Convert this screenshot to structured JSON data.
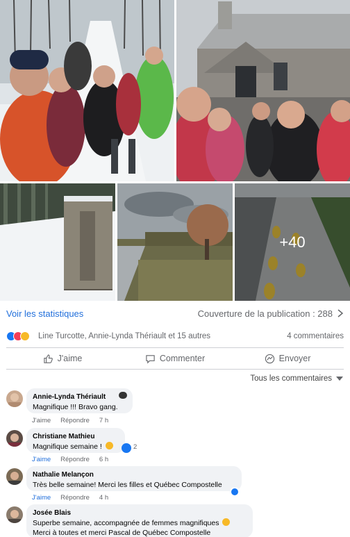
{
  "photos": {
    "more_count": "+40"
  },
  "stats": {
    "view_stats_label": "Voir les statistiques",
    "reach_label": "Couverture de la publication : 288"
  },
  "reactions": {
    "names": "Line Turcotte, Annie-Lynda Thériault et 15 autres",
    "comment_count": "4 commentaires"
  },
  "actions": {
    "like": "J'aime",
    "comment": "Commenter",
    "send": "Envoyer"
  },
  "filter": {
    "label": "Tous les commentaires"
  },
  "comments": [
    {
      "author": "Annie-Lynda Thériault",
      "text": "Magnifique !!! Bravo gang.",
      "like": "J'aime",
      "reply": "Répondre",
      "time": "7 h"
    },
    {
      "author": "Christiane Mathieu",
      "text": "Magnifique semaine !",
      "like": "J'aime",
      "reply": "Répondre",
      "time": "6 h",
      "reaction_count": "2"
    },
    {
      "author": "Nathalie Melançon",
      "text": "Très belle semaine! Merci les filles et Québec Compostelle",
      "like": "J'aime",
      "reply": "Répondre",
      "time": "4 h"
    },
    {
      "author": "Josée Blais",
      "text_line1": "Superbe semaine, accompagnée de femmes magnifiques",
      "text_line2": "Merci à toutes et merci Pascal de Québec Compostelle"
    }
  ],
  "colors": {
    "link_blue": "#216fdb",
    "bubble_gray": "#f0f2f5",
    "meta_gray": "#65676b",
    "like_blue": "#1877f2",
    "love_red": "#f33e58"
  }
}
